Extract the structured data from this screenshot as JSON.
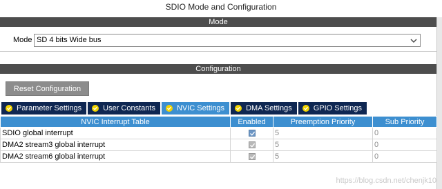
{
  "window": {
    "title": "SDIO Mode and Configuration"
  },
  "mode_section": {
    "header": "Mode",
    "mode_label": "Mode",
    "mode_value": "SD 4 bits Wide bus",
    "dropdown_icon": "chevron-down-icon"
  },
  "config_section": {
    "header": "Configuration",
    "reset_button": "Reset Configuration"
  },
  "tabs": [
    {
      "label": "Parameter Settings",
      "active": false,
      "icon": "check-circle-icon"
    },
    {
      "label": "User Constants",
      "active": false,
      "icon": "check-circle-icon"
    },
    {
      "label": "NVIC Settings",
      "active": true,
      "icon": "check-circle-icon"
    },
    {
      "label": "DMA Settings",
      "active": false,
      "icon": "check-circle-icon"
    },
    {
      "label": "GPIO Settings",
      "active": false,
      "icon": "check-circle-icon"
    }
  ],
  "table": {
    "columns": [
      "NVIC Interrupt Table",
      "Enabled",
      "Preemption Priority",
      "Sub Priority"
    ],
    "rows": [
      {
        "name": "SDIO global interrupt",
        "enabled": true,
        "preemption": "5",
        "sub": "0"
      },
      {
        "name": "DMA2 stream3 global interrupt",
        "enabled": true,
        "preemption": "5",
        "sub": "0"
      },
      {
        "name": "DMA2 stream6 global interrupt",
        "enabled": true,
        "preemption": "5",
        "sub": "0"
      }
    ]
  },
  "colors": {
    "section_bar": "#4d4d4d",
    "tab_inactive": "#0f2752",
    "tab_active": "#3d8fd0",
    "table_header": "#3d8fd0",
    "tab_dot": "#f3d400"
  },
  "watermark": "https://blog.csdn.net/chenjk10"
}
